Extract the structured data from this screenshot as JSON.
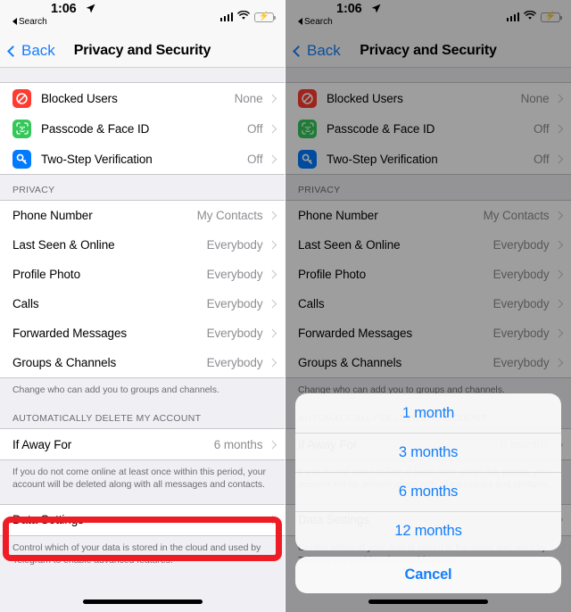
{
  "status_bar": {
    "time": "1:06",
    "back_app": "Search",
    "location_icon": "location-arrow-icon",
    "signal_icon": "cellular-signal-icon",
    "wifi_icon": "wifi-icon",
    "battery_icon": "battery-charging-icon"
  },
  "nav": {
    "back_label": "Back",
    "title": "Privacy and Security"
  },
  "security_group": {
    "rows": [
      {
        "label": "Blocked Users",
        "value": "None",
        "icon": "blocked-users-icon"
      },
      {
        "label": "Passcode & Face ID",
        "value": "Off",
        "icon": "face-id-icon"
      },
      {
        "label": "Two-Step Verification",
        "value": "Off",
        "icon": "key-icon"
      }
    ]
  },
  "privacy_section": {
    "header": "PRIVACY",
    "rows": [
      {
        "label": "Phone Number",
        "value": "My Contacts"
      },
      {
        "label": "Last Seen & Online",
        "value": "Everybody"
      },
      {
        "label": "Profile Photo",
        "value": "Everybody"
      },
      {
        "label": "Calls",
        "value": "Everybody"
      },
      {
        "label": "Forwarded Messages",
        "value": "Everybody"
      },
      {
        "label": "Groups & Channels",
        "value": "Everybody"
      }
    ],
    "footer": "Change who can add you to groups and channels."
  },
  "delete_section": {
    "header": "AUTOMATICALLY DELETE MY ACCOUNT",
    "row": {
      "label": "If Away For",
      "value": "6 months"
    },
    "footer": "If you do not come online at least once within this period, your account will be deleted along with all messages and contacts."
  },
  "data_section": {
    "row": {
      "label": "Data Settings"
    },
    "footer": "Control which of your data is stored in the cloud and used by Telegram to enable advanced features."
  },
  "action_sheet": {
    "options": [
      "1 month",
      "3 months",
      "6 months",
      "12 months"
    ],
    "cancel_label": "Cancel"
  },
  "annotation": {
    "highlight_color": "#ee1c25"
  }
}
